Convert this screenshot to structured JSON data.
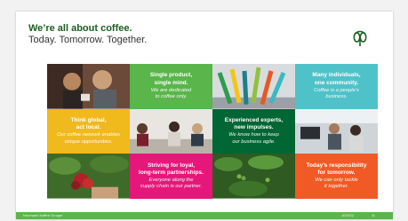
{
  "header": {
    "title": "We’re all about coffee.",
    "subtitle": "Today. Tomorrow. Together.",
    "logo_icon": "coffee-plant-logo-icon"
  },
  "tiles": [
    {
      "heading": "Single product,\nsingle mind.",
      "sub": "We are dedicated\nto coffee only.",
      "color": "#5ab54b"
    },
    {
      "heading": "Many individuals,\none community.",
      "sub": "Coffee is a people’s\nbusiness.",
      "color": "#4fc2c9"
    },
    {
      "heading": "Think global,\nact local.",
      "sub": "Our coffee network enables\nunique opportunities.",
      "color": "#f0b91c"
    },
    {
      "heading": "Experienced experts,\nnew impulses.",
      "sub": "We know how to keep\nour business agile.",
      "color": "#006633"
    },
    {
      "heading": "Striving for loyal,\nlong-term partnerships.",
      "sub": "Everyone along the\nsupply chain is our partner.",
      "color": "#e6177a"
    },
    {
      "heading": "Today’s responsibility\nfor tomorrow.",
      "sub": "We can only tackle\nit together.",
      "color": "#f15a24"
    }
  ],
  "photos": [
    "coffee-tasting-photo",
    "colorful-pipes-photo",
    "team-meeting-photo",
    "office-workers-photo",
    "coffee-harvest-photo",
    "coffee-plant-photo"
  ],
  "footer": {
    "company": "Neumann Kaffee Gruppe",
    "date": "6/29/22",
    "page": "11",
    "color": "#5ab54b"
  }
}
